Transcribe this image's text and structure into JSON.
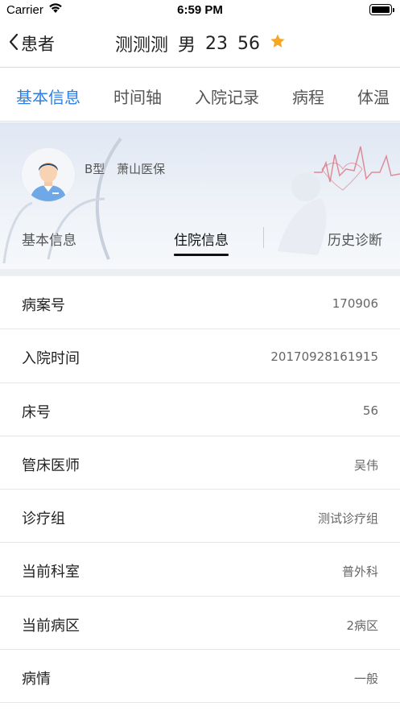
{
  "status_bar": {
    "carrier": "Carrier",
    "time": "6:59 PM",
    "wifi_icon": "wifi-icon",
    "battery_icon": "battery-icon"
  },
  "nav": {
    "back_label": "患者",
    "back_icon": "chevron-left-icon",
    "patient_name": "测测测",
    "gender": "男",
    "age": "23",
    "bed": "56",
    "favorite_icon": "star-icon",
    "favorite_color": "#f5a623"
  },
  "top_tabs": [
    {
      "label": "基本信息",
      "active": true
    },
    {
      "label": "时间轴",
      "active": false
    },
    {
      "label": "入院记录",
      "active": false
    },
    {
      "label": "病程",
      "active": false
    },
    {
      "label": "体温",
      "active": false
    }
  ],
  "accent_color": "#2a7ee6",
  "banner": {
    "blood_type": "B型",
    "insurance": "萧山医保",
    "avatar_icon": "doctor-avatar-icon",
    "sub_tabs": [
      {
        "label": "基本信息",
        "active": false
      },
      {
        "label": "住院信息",
        "active": true
      },
      {
        "label": "历史诊断",
        "active": false
      }
    ]
  },
  "info_rows": [
    {
      "label": "病案号",
      "value": "170906"
    },
    {
      "label": "入院时间",
      "value": "20170928161915"
    },
    {
      "label": "床号",
      "value": "56"
    },
    {
      "label": "管床医师",
      "value": "吴伟"
    },
    {
      "label": "诊疗组",
      "value": "测试诊疗组"
    },
    {
      "label": "当前科室",
      "value": "普外科"
    },
    {
      "label": "当前病区",
      "value": "2病区"
    },
    {
      "label": "病情",
      "value": "一般"
    }
  ]
}
